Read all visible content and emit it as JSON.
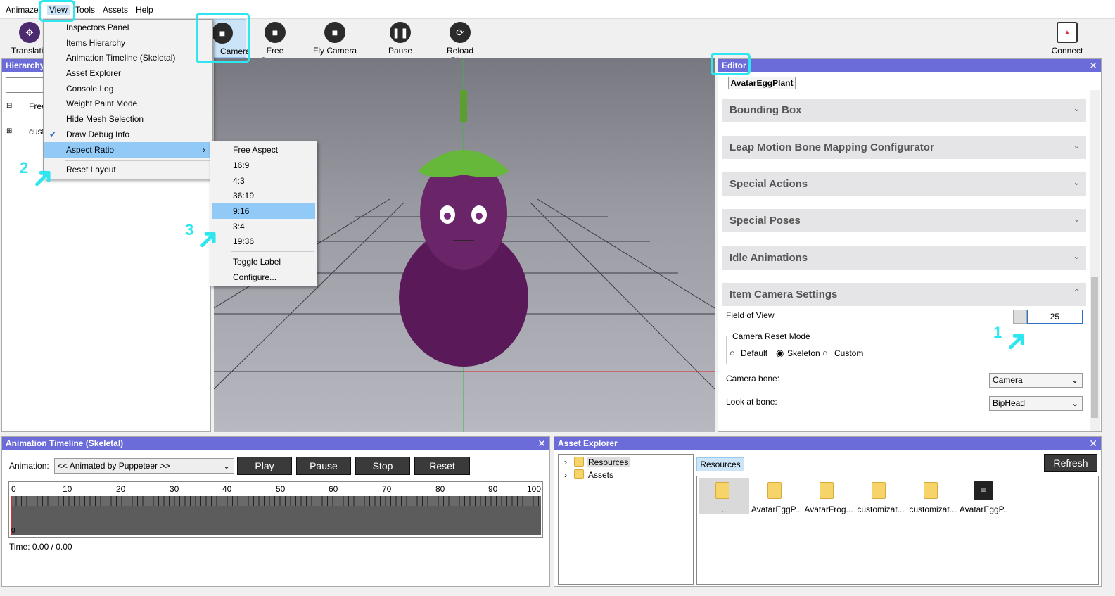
{
  "menubar": {
    "items": [
      "Animaze",
      "View",
      "Tools",
      "Assets",
      "Help"
    ]
  },
  "toolbar": {
    "translation_label": "Translatio",
    "camera_label": "Camera",
    "free_camera_label": "Free Camera",
    "fly_camera_label": "Fly Camera",
    "pause_label": "Pause",
    "reload_label": "Reload Phys",
    "connect_label": "Connect"
  },
  "hierarchy": {
    "title": "Hierarchy",
    "tree": [
      "Free",
      "cust"
    ]
  },
  "view_menu": {
    "items": [
      "Inspectors Panel",
      "Items Hierarchy",
      "Animation Timeline (Skeletal)",
      "Asset Explorer",
      "Console Log",
      "Weight Paint Mode",
      "Hide Mesh Selection",
      "Draw Debug Info",
      "Aspect Ratio",
      "Reset Layout"
    ]
  },
  "aspect_menu": {
    "items": [
      "Free Aspect",
      "16:9",
      "4:3",
      "36:19",
      "9:16",
      "3:4",
      "19:36",
      "Toggle Label",
      "Configure..."
    ],
    "selected": "9:16"
  },
  "annotations": {
    "one": "1",
    "two": "2",
    "three": "3"
  },
  "editor": {
    "title": "Editor",
    "tab": "AvatarEggPlant",
    "sections": [
      "Bounding Box",
      "Leap Motion Bone Mapping Configurator",
      "Special Actions",
      "Special Poses",
      "Idle Animations",
      "Item Camera Settings"
    ],
    "fov_label": "Field of View",
    "fov_value": "25",
    "reset_mode_label": "Camera Reset Mode",
    "reset_modes": [
      "Default",
      "Skeleton",
      "Custom"
    ],
    "reset_mode_selected": "Skeleton",
    "camera_bone_label": "Camera bone:",
    "camera_bone_value": "Camera",
    "look_bone_label": "Look at bone:",
    "look_bone_value": "BipHead"
  },
  "timeline": {
    "title": "Animation Timeline (Skeletal)",
    "animation_label": "Animation:",
    "animation_value": "<< Animated by Puppeteer >>",
    "buttons": [
      "Play",
      "Pause",
      "Stop",
      "Reset"
    ],
    "ticks": [
      "0",
      "10",
      "20",
      "30",
      "40",
      "50",
      "60",
      "70",
      "80",
      "90",
      "100"
    ],
    "row_zero": "0",
    "time_text": "Time: 0.00 / 0.00"
  },
  "assets": {
    "title": "Asset Explorer",
    "tree": [
      "Resources",
      "Assets"
    ],
    "breadcrumb": "Resources",
    "refresh_label": "Refresh",
    "files": [
      "..",
      "AvatarEggP...",
      "AvatarFrog...",
      "customizat...",
      "customizat...",
      "AvatarEggP..."
    ]
  },
  "colors": {
    "accent": "#6b6bd9",
    "highlight": "#2ee6f0",
    "menu_select": "#91c9f7"
  }
}
